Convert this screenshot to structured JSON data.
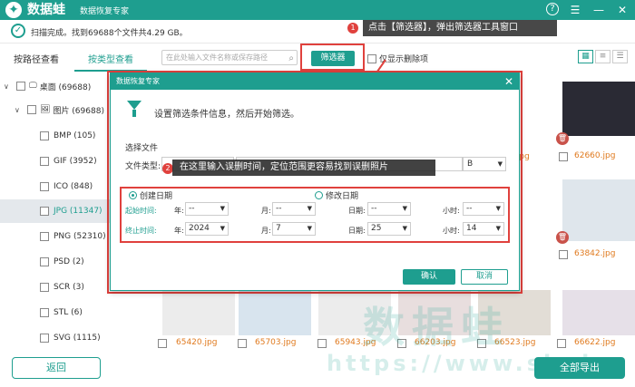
{
  "app": {
    "brand": "数据蛙",
    "title": "数据恢复专家",
    "icons": [
      "help-icon",
      "menu-icon",
      "minimize-icon",
      "close-icon"
    ]
  },
  "status": {
    "text": "扫描完成。找到69688个文件共4.29 GB。"
  },
  "tabs": [
    {
      "label": "按路径查看",
      "active": false
    },
    {
      "label": "按类型查看",
      "active": true
    }
  ],
  "toolbar": {
    "search_placeholder": "在此处输入文件名称或保存路径",
    "filter_label": "筛选器",
    "only_deleted_label": "仅显示删除项"
  },
  "callouts": {
    "step1_num": "1",
    "step1_text": "点击【筛选器】，弹出筛选器工具窗口",
    "step2_num": "2",
    "step2_text": "在这里输入误删时间，定位范围更容易找到误删照片"
  },
  "tree": [
    {
      "label": "桌面 (69688)",
      "level": 0,
      "expanded": true
    },
    {
      "label": "图片 (69688)",
      "level": 1,
      "expanded": true
    },
    {
      "label": "BMP (105)",
      "level": 2
    },
    {
      "label": "GIF (3952)",
      "level": 2
    },
    {
      "label": "ICO (848)",
      "level": 2
    },
    {
      "label": "JPG (11347)",
      "level": 2,
      "selected": true
    },
    {
      "label": "PNG (52310)",
      "level": 2
    },
    {
      "label": "PSD (2)",
      "level": 2
    },
    {
      "label": "SCR (3)",
      "level": 2
    },
    {
      "label": "STL (6)",
      "level": 2
    },
    {
      "label": "SVG (1115)",
      "level": 2
    }
  ],
  "thumbnails": {
    "right_column": [
      "62660.jpg",
      "63842.jpg",
      "66622.jpg"
    ],
    "bottom_row": [
      "65420.jpg",
      "65703.jpg",
      "65943.jpg",
      "66203.jpg",
      "66523.jpg",
      "66622.jpg"
    ],
    "partial_mid": ".jpg"
  },
  "dialog": {
    "title": "数据恢复专家",
    "intro": "设置筛选条件信息，然后开始筛选。",
    "section_title": "选择文件",
    "file_type_label": "文件类型:",
    "size_unit": "B",
    "create_date_label": "创建日期",
    "modify_date_label": "修改日期",
    "start_label": "起始时间:",
    "end_label": "终止时间:",
    "year_label": "年:",
    "month_label": "月:",
    "day_label": "日期:",
    "hour_label": "小时:",
    "start": {
      "year": "--",
      "month": "--",
      "day": "--",
      "hour": "--"
    },
    "end": {
      "year": "2024",
      "month": "7",
      "day": "25",
      "hour": "14"
    },
    "ok_label": "确认",
    "cancel_label": "取消"
  },
  "footer": {
    "back_label": "返回",
    "export_label": "全部导出"
  },
  "watermark": {
    "cn": "数据蛙",
    "url": "https://www.shuj"
  },
  "colors": {
    "accent": "#1e9e8f",
    "highlight": "#e0413d",
    "file_label": "#e07a1f"
  }
}
